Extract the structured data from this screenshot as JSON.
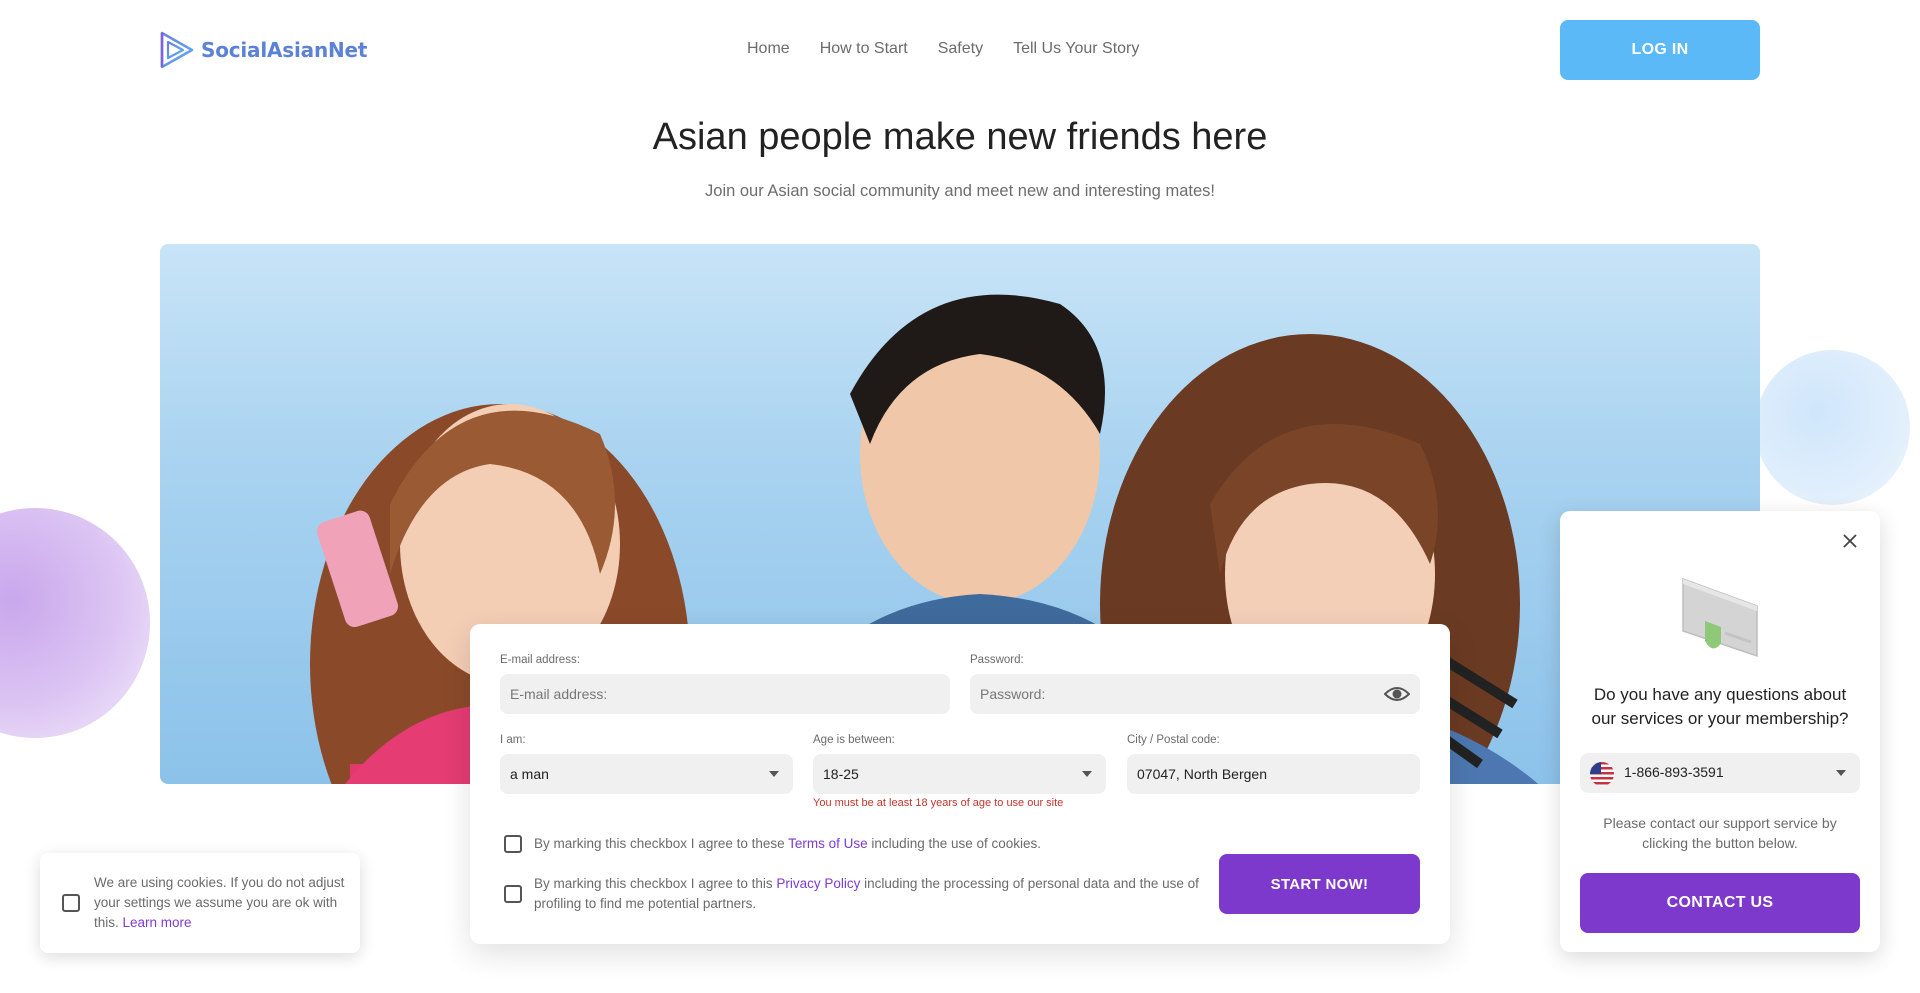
{
  "header": {
    "logo_text": "SocialAsianNet",
    "nav": [
      "Home",
      "How to Start",
      "Safety",
      "Tell Us Your Story"
    ],
    "login_label": "LOG IN"
  },
  "hero": {
    "title": "Asian people make new friends here",
    "subtitle": "Join our Asian social community and meet new and interesting mates!"
  },
  "form": {
    "email_label": "E-mail address:",
    "email_placeholder": "E-mail address:",
    "password_label": "Password:",
    "password_placeholder": "Password:",
    "iam_label": "I am:",
    "iam_value": "a man",
    "age_label": "Age is between:",
    "age_value": "18-25",
    "city_label": "City / Postal code:",
    "city_value": "07047, North Bergen",
    "age_error": "You must be at least 18 years of age to use our site",
    "terms_pre": "By marking this checkbox I agree to these ",
    "terms_link": "Terms of Use",
    "terms_post": " including the use of cookies.",
    "privacy_pre": "By marking this checkbox I agree to this ",
    "privacy_link": "Privacy Policy",
    "privacy_post": " including the processing of personal data and the use of profiling to find me potential partners.",
    "start_label": "START NOW!"
  },
  "cookie": {
    "text": "We are using cookies. If you do not adjust your settings we assume you are ok with this. ",
    "link": "Learn more"
  },
  "support": {
    "question": "Do you have any questions about our services or your membership?",
    "phone": "1-866-893-3591",
    "note": "Please contact our support service by clicking the button below.",
    "contact_label": "CONTACT US"
  },
  "colors": {
    "brand_blue": "#5bb9f7",
    "brand_purple": "#7d38cc",
    "logo_blue": "#5b82d6",
    "error_red": "#c0362c"
  },
  "icons": [
    "logo-play-icon",
    "eye-icon",
    "caret-down-icon",
    "close-icon",
    "us-flag-icon",
    "phone-card-icon"
  ]
}
